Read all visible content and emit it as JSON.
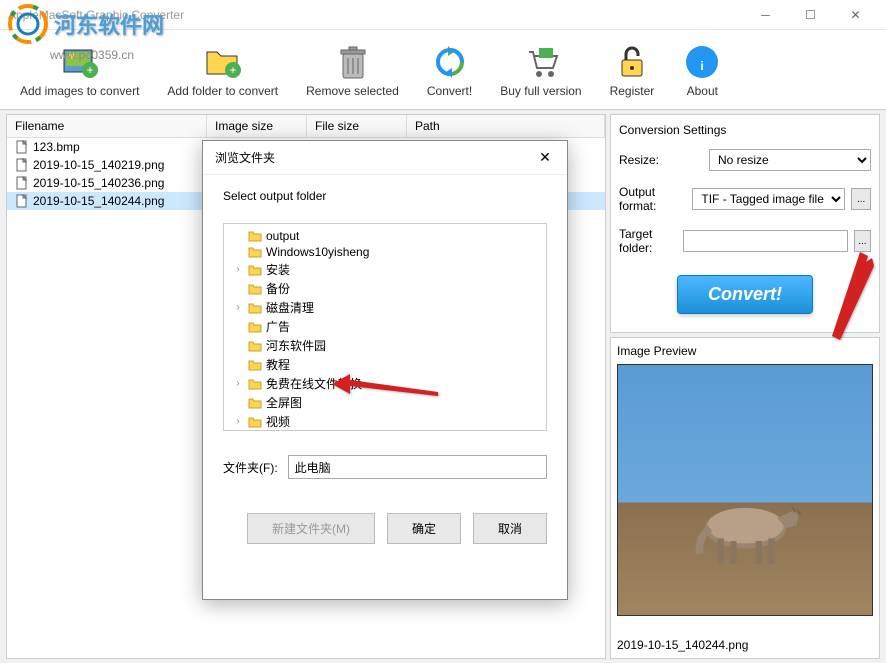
{
  "window": {
    "title": "AppleMacSoft Graphic Converter"
  },
  "watermark": {
    "text": "河东软件网",
    "url": "www.pc0359.cn"
  },
  "toolbar": {
    "add_images": "Add images to convert",
    "add_folder": "Add folder to convert",
    "remove": "Remove selected",
    "convert": "Convert!",
    "buy": "Buy full version",
    "register": "Register",
    "about": "About"
  },
  "file_header": {
    "filename": "Filename",
    "image_size": "Image size",
    "file_size": "File size",
    "path": "Path"
  },
  "files": [
    {
      "name": "123.bmp"
    },
    {
      "name": "2019-10-15_140219.png"
    },
    {
      "name": "2019-10-15_140236.png"
    },
    {
      "name": "2019-10-15_140244.png",
      "selected": true
    }
  ],
  "settings": {
    "title": "Conversion Settings",
    "resize_label": "Resize:",
    "resize_value": "No resize",
    "format_label": "Output format:",
    "format_value": "TIF - Tagged image file",
    "target_label": "Target folder:",
    "target_value": "",
    "convert_button": "Convert!"
  },
  "preview": {
    "title": "Image Preview",
    "filename": "2019-10-15_140244.png"
  },
  "dialog": {
    "title": "浏览文件夹",
    "subtitle": "Select output folder",
    "folder_label": "文件夹(F):",
    "folder_value": "此电脑",
    "new_folder": "新建文件夹(M)",
    "ok": "确定",
    "cancel": "取消",
    "tree": [
      {
        "label": "output",
        "expandable": false
      },
      {
        "label": "Windows10yisheng",
        "expandable": false
      },
      {
        "label": "安装",
        "expandable": true
      },
      {
        "label": "备份",
        "expandable": false
      },
      {
        "label": "磁盘清理",
        "expandable": true
      },
      {
        "label": "广告",
        "expandable": false
      },
      {
        "label": "河东软件园",
        "expandable": false,
        "highlight": true
      },
      {
        "label": "教程",
        "expandable": false
      },
      {
        "label": "免费在线文件转换",
        "expandable": true
      },
      {
        "label": "全屏图",
        "expandable": false
      },
      {
        "label": "视频",
        "expandable": true
      }
    ]
  }
}
